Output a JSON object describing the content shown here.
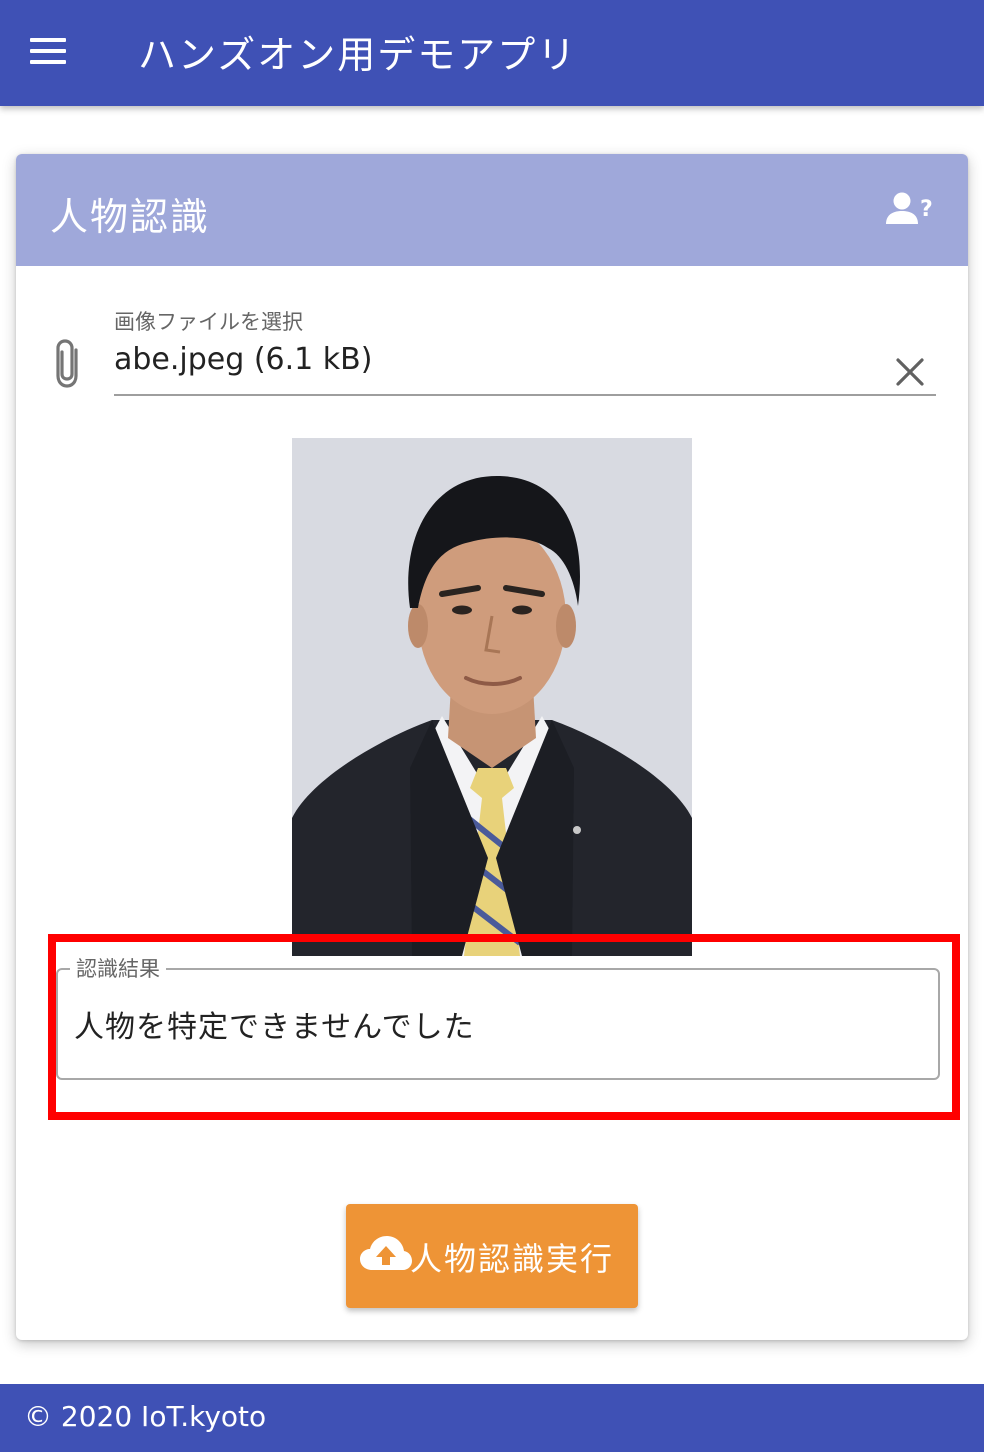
{
  "app_bar": {
    "title": "ハンズオン用デモアプリ",
    "menu_icon": "menu-icon"
  },
  "card": {
    "title": "人物認識",
    "help_icon": "person-question-icon"
  },
  "file_input": {
    "label": "画像ファイルを選択",
    "value": "abe.jpeg (6.1 kB)",
    "prepend_icon": "paperclip-icon",
    "clear_icon": "close-icon"
  },
  "result": {
    "label": "認識結果",
    "value": "人物を特定できませんでした"
  },
  "run_button": {
    "label": "人物認識実行",
    "icon": "cloud-upload-icon"
  },
  "footer": {
    "text": "© 2020 IoT.kyoto"
  },
  "colors": {
    "primary": "#3f51b5",
    "card_header": "#9fa8da",
    "accent": "#ee9436",
    "highlight": "#ff0000"
  }
}
